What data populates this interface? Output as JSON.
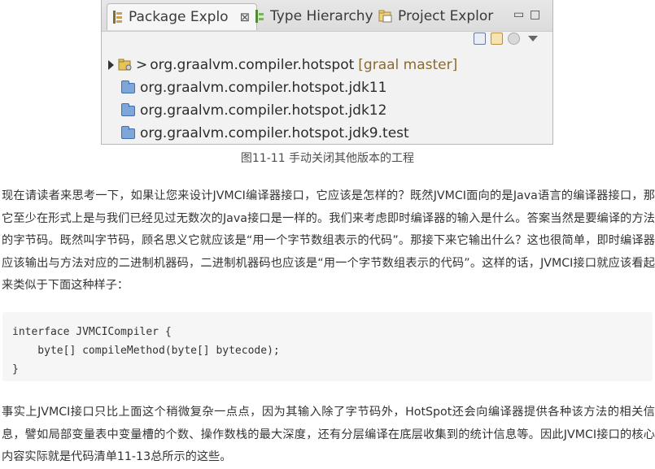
{
  "ide": {
    "tabs": [
      {
        "label": "Package Explo",
        "icon": "package-explorer-icon",
        "active": true
      },
      {
        "label": "Type Hierarchy",
        "icon": "type-hierarchy-icon",
        "active": false
      },
      {
        "label": "Project Explor",
        "icon": "project-explorer-icon",
        "active": false
      }
    ],
    "close_glyph": "⊠",
    "minimize_glyph": "▭",
    "maximize_glyph": "□",
    "tree": {
      "root": {
        "prefix": ">",
        "name": "org.graalvm.compiler.hotspot",
        "repo": "[graal master]"
      },
      "children": [
        "org.graalvm.compiler.hotspot.jdk11",
        "org.graalvm.compiler.hotspot.jdk12",
        "org.graalvm.compiler.hotspot.jdk9.test"
      ]
    }
  },
  "caption": "图11-11 手动关闭其他版本的工程",
  "paragraph1": "现在请读者来思考一下，如果让您来设计JVMCI编译器接口，它应该是怎样的？既然JVMCI面向的是Java语言的编译器接口，那它至少在形式上是与我们已经见过无数次的Java接口是一样的。我们来考虑即时编译器的输入是什么。答案当然是要编译的方法的字节码。既然叫字节码，顾名思义它就应该是“用一个字节数组表示的代码”。那接下来它输出什么？这也很简单，即时编译器应该输出与方法对应的二进制机器码，二进制机器码也应该是“用一个字节数组表示的代码”。这样的话，JVMCI接口就应该看起来类似于下面这种样子：",
  "code": [
    "interface JVMCICompiler {",
    "    byte[] compileMethod(byte[] bytecode);",
    "}"
  ],
  "paragraph2": "事实上JVMCI接口只比上面这个稍微复杂一点点，因为其输入除了字节码外，HotSpot还会向编译器提供各种该方法的相关信息，譬如局部变量表中变量槽的个数、操作数栈的最大深度，还有分层编译在底层收集到的统计信息等。因此JVMCI接口的核心内容实际就是代码清单11-13总所示的这些。"
}
